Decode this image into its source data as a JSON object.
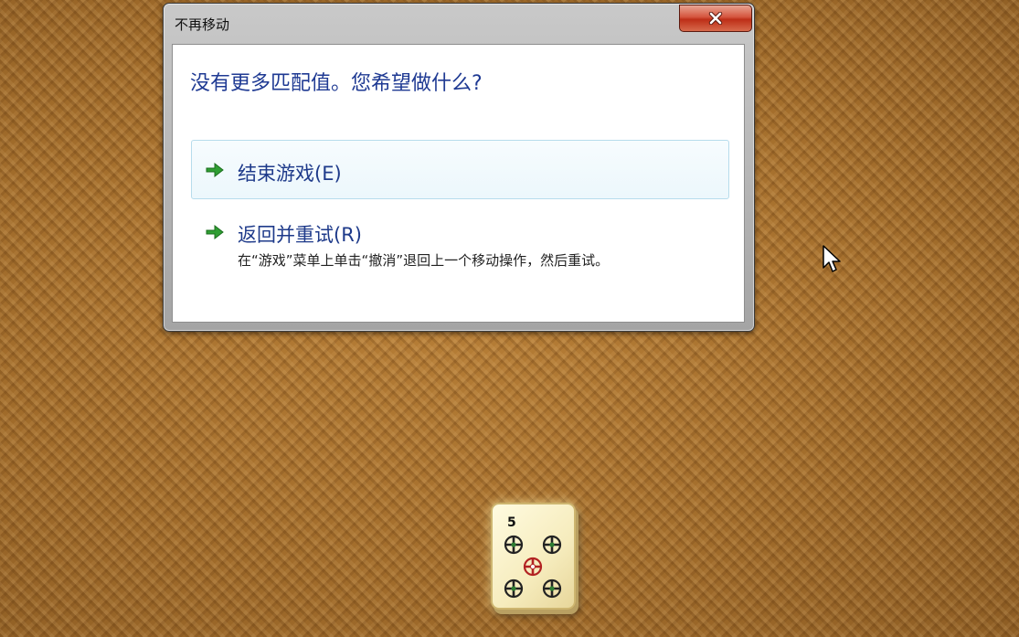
{
  "dialog": {
    "title": "不再移动",
    "close_icon": "close-icon",
    "instruction": "没有更多匹配值。您希望做什么?",
    "options": [
      {
        "label": "结束游戏(E)",
        "icon": "green-arrow-icon",
        "note": ""
      },
      {
        "label": "返回并重试(R)",
        "icon": "green-arrow-icon",
        "note": "在“游戏”菜单上单击“撤消”退回上一个移动操作，然后重试。"
      }
    ]
  },
  "board": {
    "tile": {
      "number": "5",
      "suit_icon": "circle-five-icon"
    }
  },
  "cursor": {
    "icon": "mouse-pointer-icon"
  }
}
